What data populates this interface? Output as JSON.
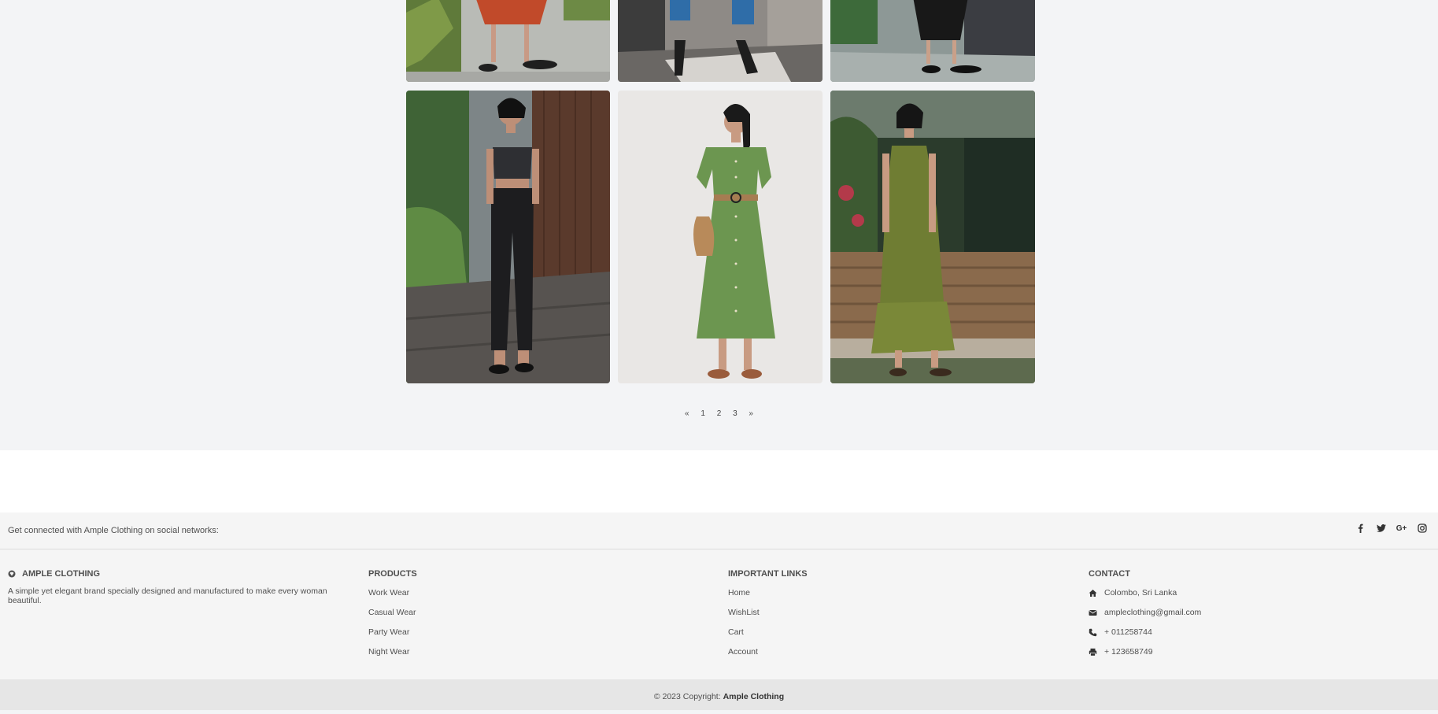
{
  "gallery": {
    "photos": [
      {
        "alt": "model-red-skirt"
      },
      {
        "alt": "model-denim-jeans"
      },
      {
        "alt": "model-black-outfit"
      },
      {
        "alt": "model-black-crop-top-satin-pants"
      },
      {
        "alt": "model-green-shirt-dress"
      },
      {
        "alt": "model-olive-slip-dress"
      }
    ]
  },
  "pagination": {
    "prev": "«",
    "pages": [
      "1",
      "2",
      "3"
    ],
    "next": "»"
  },
  "footer": {
    "social_text": "Get connected with Ample Clothing on social networks:",
    "social_icons": [
      "facebook-icon",
      "twitter-icon",
      "google-plus-icon",
      "instagram-icon"
    ],
    "brand": {
      "title": "AMPLE CLOTHING",
      "description": "A simple yet elegant brand specially designed and manufactured to make every woman beautiful."
    },
    "products": {
      "title": "PRODUCTS",
      "items": [
        "Work Wear",
        "Casual Wear",
        "Party Wear",
        "Night Wear"
      ]
    },
    "links": {
      "title": "IMPORTANT LINKS",
      "items": [
        "Home",
        "WishList",
        "Cart",
        "Account"
      ]
    },
    "contact": {
      "title": "CONTACT",
      "address": "Colombo, Sri Lanka",
      "email": "ampleclothing@gmail.com",
      "phone": "+ 011258744",
      "fax": "+ 123658749"
    }
  },
  "copyright": {
    "prefix": "© 2023 Copyright:",
    "brand": "Ample Clothing"
  }
}
